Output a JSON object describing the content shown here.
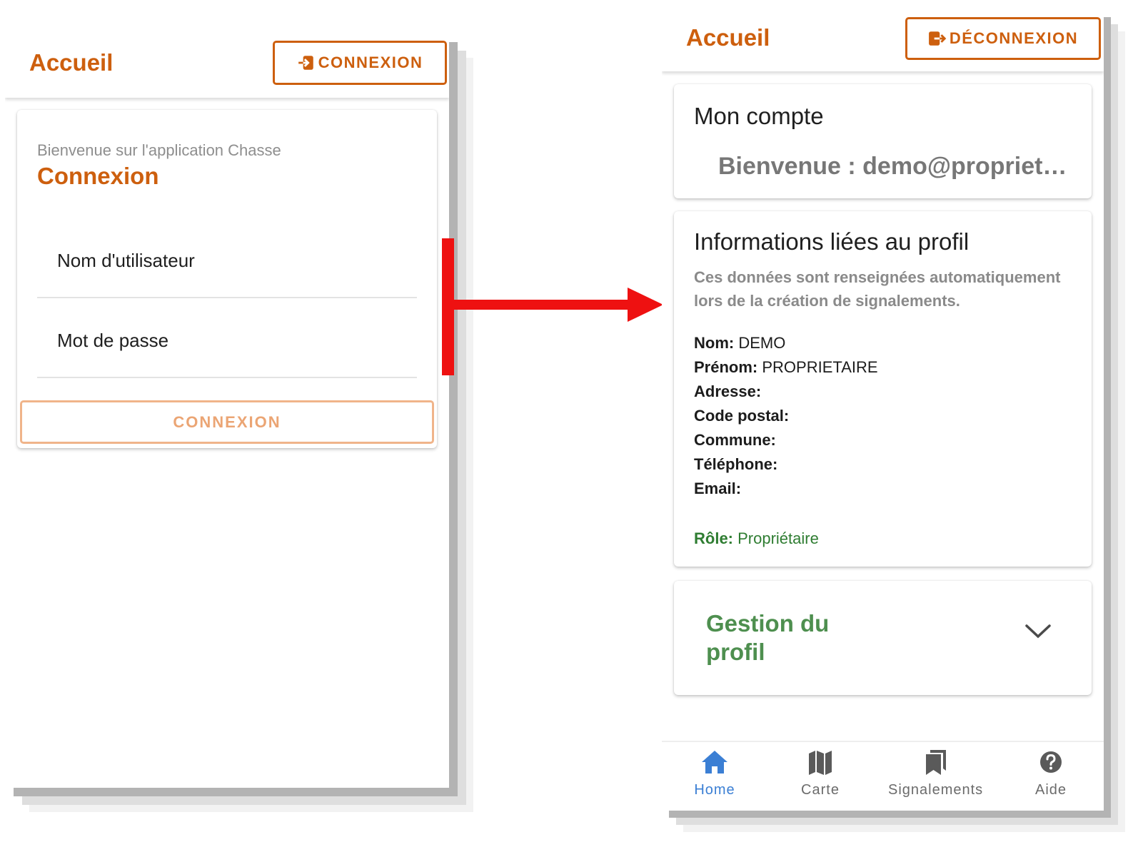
{
  "left_screen": {
    "topbar": {
      "title": "Accueil",
      "login_button_label": "CONNEXION"
    },
    "login_card": {
      "welcome": "Bienvenue sur l'application Chasse",
      "title": "Connexion",
      "username_label": "Nom d'utilisateur",
      "password_label": "Mot de passe",
      "submit_label": "CONNEXION"
    }
  },
  "right_screen": {
    "topbar": {
      "title": "Accueil",
      "logout_button_label": "DÉCONNEXION"
    },
    "account_card": {
      "title": "Mon compte",
      "greeting": "Bienvenue : demo@propriet…"
    },
    "profile_card": {
      "title": "Informations liées au profil",
      "description": "Ces données sont renseignées automatiquement lors de la création de signalements.",
      "fields": [
        {
          "label": "Nom:",
          "value": "DEMO"
        },
        {
          "label": "Prénom:",
          "value": "PROPRIETAIRE"
        },
        {
          "label": "Adresse:",
          "value": ""
        },
        {
          "label": "Code postal:",
          "value": ""
        },
        {
          "label": "Commune:",
          "value": ""
        },
        {
          "label": "Téléphone:",
          "value": ""
        },
        {
          "label": "Email:",
          "value": ""
        }
      ],
      "role": {
        "label": "Rôle:",
        "value": "Propriétaire"
      }
    },
    "manage_card": {
      "title": "Gestion du profil"
    },
    "bottom_nav": [
      {
        "label": "Home",
        "icon": "home-icon",
        "active": true
      },
      {
        "label": "Carte",
        "icon": "map-icon",
        "active": false
      },
      {
        "label": "Signalements",
        "icon": "bookmarks-icon",
        "active": false
      },
      {
        "label": "Aide",
        "icon": "help-icon",
        "active": false
      }
    ]
  },
  "colors": {
    "accent": "#cd5f0e",
    "accent_light": "#f0b48a",
    "green": "#2f7d32",
    "nav_active": "#3b7fd4",
    "arrow": "#ee1111"
  }
}
